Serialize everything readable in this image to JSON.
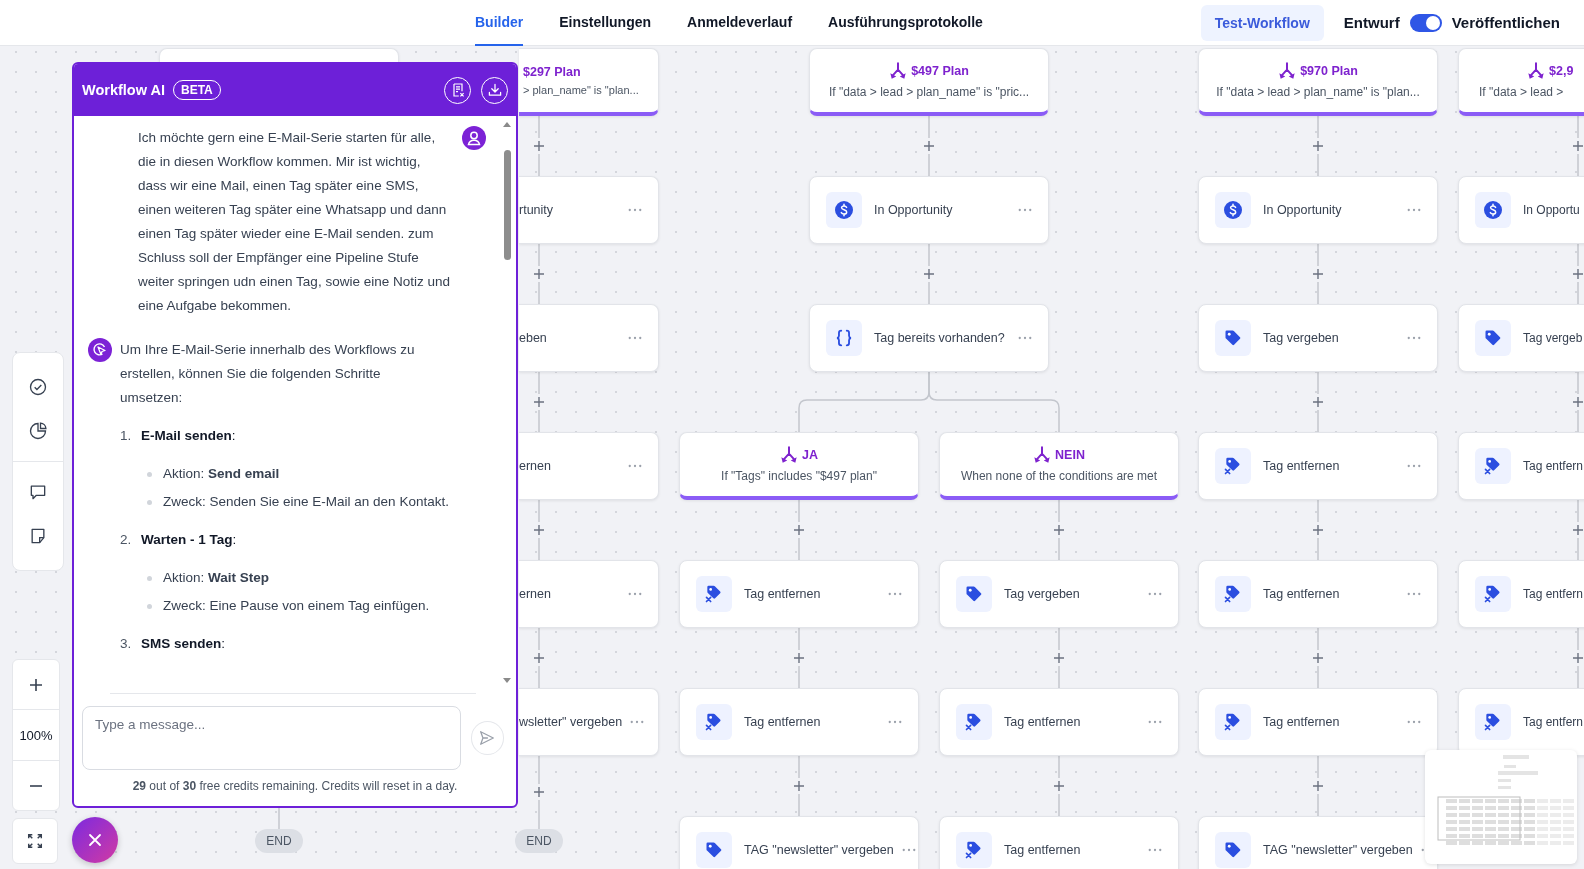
{
  "top_bar": {
    "tabs": [
      {
        "label": "Builder",
        "selected": true
      },
      {
        "label": "Einstellungen",
        "selected": false
      },
      {
        "label": "Anmeldeverlauf",
        "selected": false
      },
      {
        "label": "Ausführungsprotokolle",
        "selected": false
      }
    ],
    "test_button": "Test-Workflow",
    "draft_label": "Entwurf",
    "publish_toggle": {
      "on": true
    },
    "publish_label": "Veröffentlichen"
  },
  "canvas": {
    "lanes": [
      {
        "steps": [
          {
            "kind": "covered"
          }
        ],
        "end": "END"
      },
      {
        "steps": [
          {
            "kind": "branch",
            "title": "$297 Plan",
            "condition": "> plan_name\" is \"plan..."
          },
          {
            "kind": "action",
            "label": "rtunity"
          },
          {
            "kind": "action",
            "label": "eben"
          },
          {
            "kind": "action",
            "label": "ernen"
          },
          {
            "kind": "action",
            "label": "ernen"
          },
          {
            "kind": "action",
            "label": "wsletter\" vergeben"
          }
        ],
        "end": "END"
      },
      {
        "steps": [
          {
            "kind": "branch",
            "title": "$497 Plan",
            "condition": "If \"data > lead > plan_name\" is \"pric..."
          },
          {
            "kind": "opportunity",
            "label": "In Opportunity"
          },
          {
            "kind": "condition",
            "label": "Tag bereits vorhanden?"
          }
        ],
        "branches": [
          {
            "steps": [
              {
                "kind": "branch",
                "title": "JA",
                "condition": "If \"Tags\" includes \"$497 plan\""
              },
              {
                "kind": "remove-tag",
                "label": "Tag entfernen"
              },
              {
                "kind": "remove-tag",
                "label": "Tag entfernen"
              },
              {
                "kind": "add-tag",
                "label": "TAG \"newsletter\" vergeben"
              }
            ]
          },
          {
            "steps": [
              {
                "kind": "branch",
                "title": "NEIN",
                "condition": "When none of the conditions are met"
              },
              {
                "kind": "add-tag",
                "label": "Tag vergeben"
              },
              {
                "kind": "remove-tag",
                "label": "Tag entfernen"
              },
              {
                "kind": "remove-tag",
                "label": "Tag entfernen"
              }
            ]
          }
        ]
      },
      {
        "steps": [
          {
            "kind": "branch",
            "title": "$970 Plan",
            "condition": "If \"data > lead > plan_name\" is \"plan..."
          },
          {
            "kind": "opportunity",
            "label": "In Opportunity"
          },
          {
            "kind": "add-tag",
            "label": "Tag vergeben"
          },
          {
            "kind": "remove-tag",
            "label": "Tag entfernen"
          },
          {
            "kind": "remove-tag",
            "label": "Tag entfernen"
          },
          {
            "kind": "remove-tag",
            "label": "Tag entfernen"
          },
          {
            "kind": "add-tag",
            "label": "TAG \"newsletter\" vergeben"
          }
        ]
      },
      {
        "steps": [
          {
            "kind": "branch",
            "title": "$2,9",
            "condition": "If \"data > lead >"
          },
          {
            "kind": "opportunity",
            "label": "In Opportu"
          },
          {
            "kind": "add-tag",
            "label": "Tag vergeb"
          },
          {
            "kind": "remove-tag",
            "label": "Tag entfern"
          },
          {
            "kind": "remove-tag",
            "label": "Tag entfern"
          },
          {
            "kind": "remove-tag",
            "label": "Tag entfern"
          }
        ]
      }
    ]
  },
  "zoom": {
    "level_text": "100%"
  },
  "ai_panel": {
    "title": "Workflow AI",
    "badge": "BETA",
    "messages": [
      {
        "kind": "user",
        "text": "Ich möchte gern eine E-Mail-Serie starten für alle, die in diesen Workflow kommen. Mir ist wichtig, dass wir eine Mail, einen Tag später eine SMS, einen weiteren Tag später eine Whatsapp und dann einen Tag später wieder eine E-Mail senden. zum Schluss soll der Empfänger eine Pipeline Stufe weiter springen udn einen Tag, sowie eine Notiz und eine Aufgabe bekommen."
      },
      {
        "kind": "assistant",
        "text": "Um Ihre E-Mail-Serie innerhalb des Workflows zu erstellen, können Sie die folgenden Schritte umsetzen:",
        "steps": [
          {
            "number": "1.",
            "title": "**E-Mail senden**:",
            "points": [
              "Aktion: **Send email**",
              "Zweck: Senden Sie eine E-Mail an den Kontakt."
            ]
          },
          {
            "number": "2.",
            "title": "**Warten - 1 Tag**:",
            "points": [
              "Aktion: **Wait Step**",
              "Zweck: Eine Pause von einem Tag einfügen."
            ]
          },
          {
            "number": "3.",
            "title": "**SMS senden**:"
          }
        ]
      }
    ],
    "input": {
      "placeholder": "Type a message..."
    },
    "credits": "**29** out of **30** free credits remaining. Credits will reset in a day."
  }
}
